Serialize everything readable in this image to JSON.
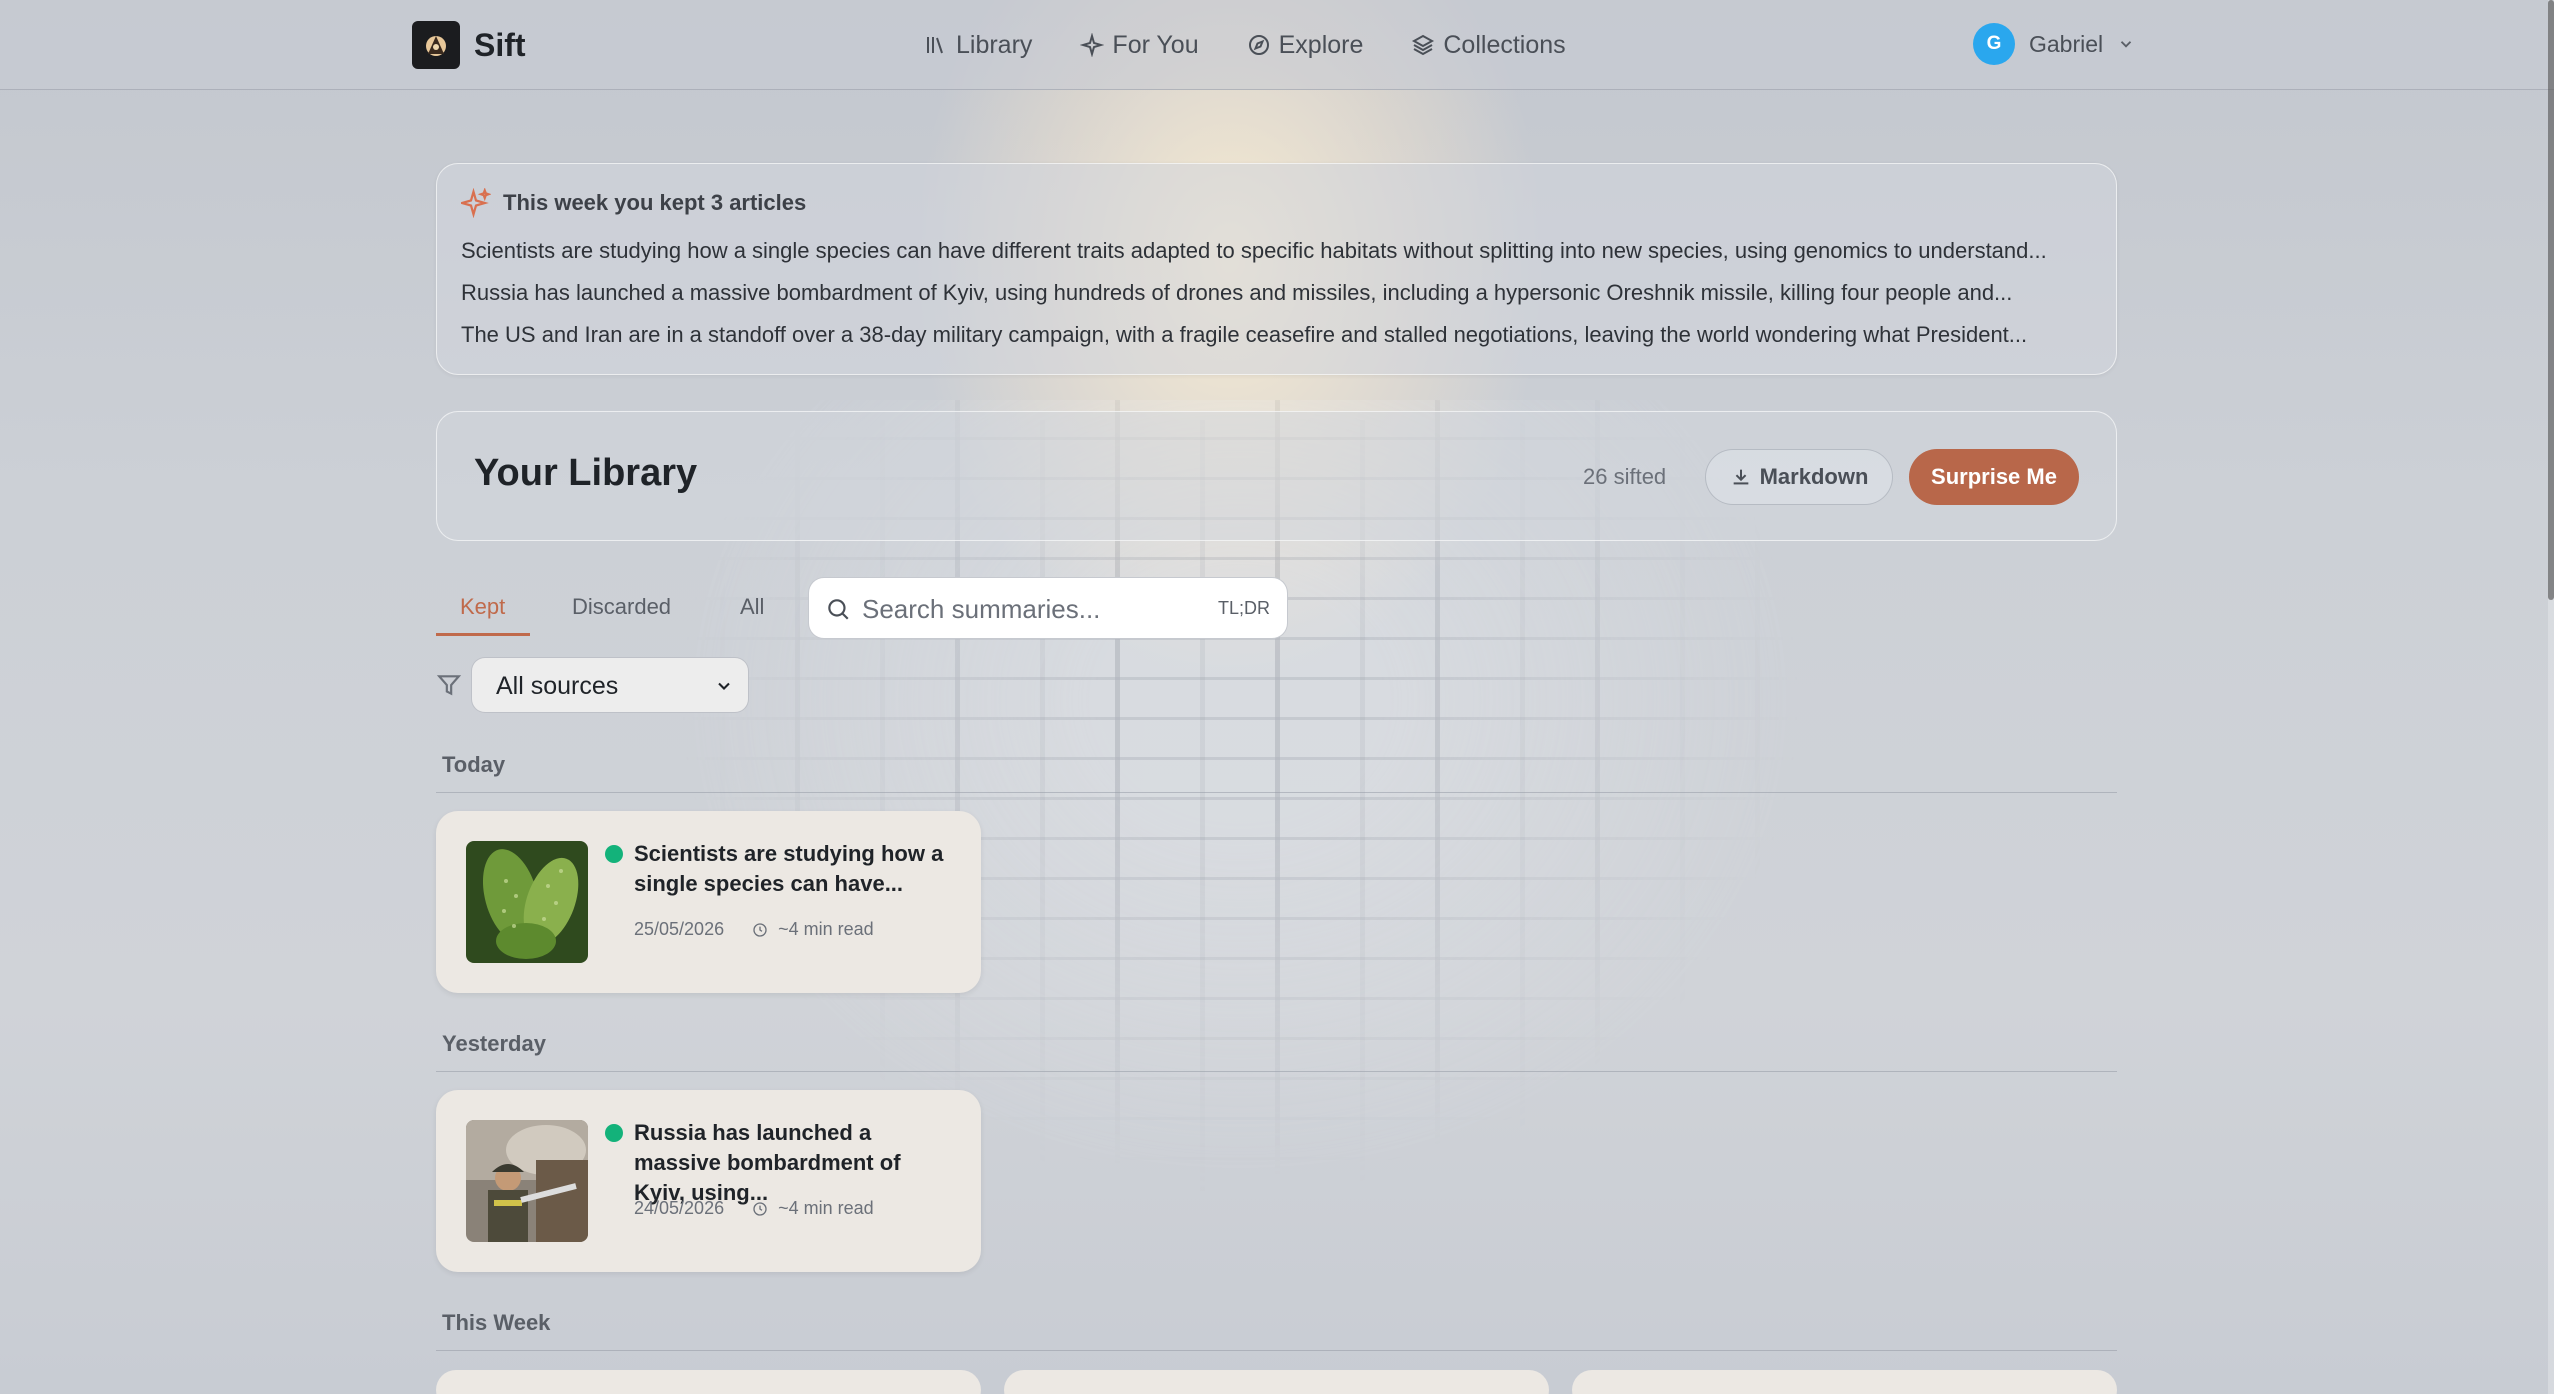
{
  "app": {
    "name": "Sift"
  },
  "nav": {
    "items": [
      {
        "label": "Library",
        "icon": "library-icon"
      },
      {
        "label": "For You",
        "icon": "sparkle-icon"
      },
      {
        "label": "Explore",
        "icon": "compass-icon"
      },
      {
        "label": "Collections",
        "icon": "layers-icon"
      }
    ]
  },
  "user": {
    "initial": "G",
    "name": "Gabriel",
    "avatar_color": "#2aa7ee"
  },
  "weekly_summary": {
    "title": "This week you kept 3 articles",
    "lines": [
      "Scientists are studying how a single species can have different traits adapted to specific habitats without splitting into new species, using genomics to understand...",
      "Russia has launched a massive bombardment of Kyiv, using hundreds of drones and missiles, including a hypersonic Oreshnik missile, killing four people and...",
      "The US and Iran are in a standoff over a 38-day military campaign, with a fragile ceasefire and stalled negotiations, leaving the world wondering what President..."
    ]
  },
  "library": {
    "title": "Your Library",
    "count_label": "26 sifted",
    "markdown_label": "Markdown",
    "surprise_label": "Surprise Me"
  },
  "tabs": {
    "kept": "Kept",
    "discarded": "Discarded",
    "all": "All",
    "active": "Kept"
  },
  "search": {
    "placeholder": "Search summaries...",
    "shortcut": "TL;DR"
  },
  "filter": {
    "selected": "All sources"
  },
  "sections": {
    "today": {
      "label": "Today",
      "items": [
        {
          "title": "Scientists are studying how a single species can have...",
          "date": "25/05/2026",
          "read_time": "~4 min read",
          "status_color": "#13b27a"
        }
      ]
    },
    "yesterday": {
      "label": "Yesterday",
      "items": [
        {
          "title": "Russia has launched a massive bombardment of Kyiv, using...",
          "date": "24/05/2026",
          "read_time": "~4 min read",
          "status_color": "#13b27a"
        }
      ]
    },
    "this_week": {
      "label": "This Week"
    }
  },
  "colors": {
    "accent": "#c06a4b",
    "surprise_button": "#b8674a",
    "status_dot": "#13b27a"
  }
}
